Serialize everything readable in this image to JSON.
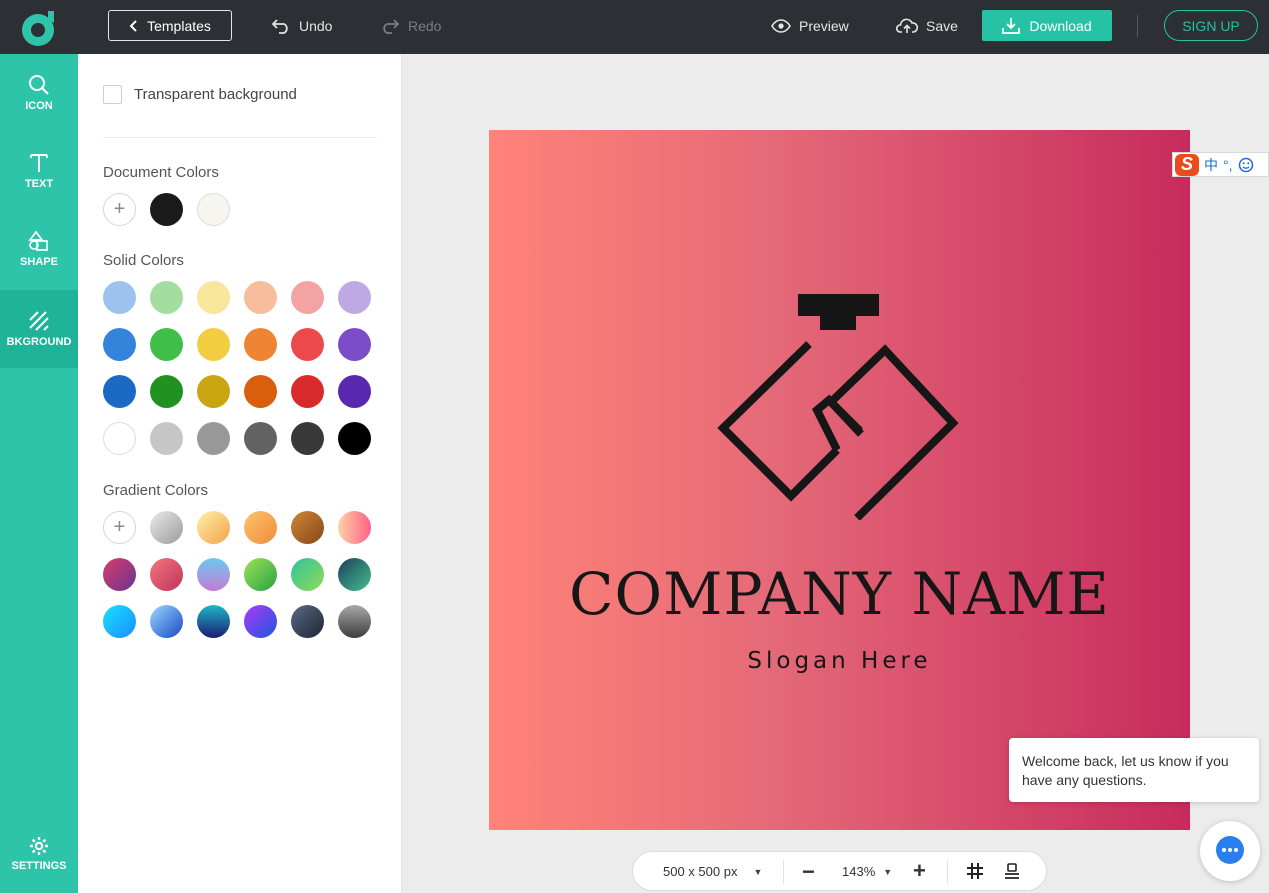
{
  "toolbar": {
    "templates_label": "Templates",
    "undo_label": "Undo",
    "redo_label": "Redo",
    "preview_label": "Preview",
    "save_label": "Save",
    "download_label": "Download",
    "signup_label": "SIGN UP"
  },
  "rail": {
    "items": [
      {
        "label": "ICON",
        "icon": "search-icon"
      },
      {
        "label": "TEXT",
        "icon": "text-icon"
      },
      {
        "label": "SHAPE",
        "icon": "shape-icon"
      },
      {
        "label": "BKGROUND",
        "icon": "background-icon",
        "active": true
      }
    ],
    "settings_label": "SETTINGS"
  },
  "panel": {
    "transparent_label": "Transparent background",
    "document_colors_title": "Document Colors",
    "solid_colors_title": "Solid Colors",
    "gradient_colors_title": "Gradient Colors",
    "document_colors": [
      "#1a1a1a",
      "#f6f5f0"
    ],
    "solid_colors": [
      [
        "#9cc2ef",
        "#a3dea0",
        "#f8e69a",
        "#f7be9c",
        "#f4a3a3",
        "#bfa9e5"
      ],
      [
        "#3484dc",
        "#3fbf48",
        "#f2cd42",
        "#ef8534",
        "#ec4a4a",
        "#7b4dc9"
      ],
      [
        "#1b69c2",
        "#21921f",
        "#c8a511",
        "#d95f0d",
        "#d82a2a",
        "#5a27b0"
      ],
      [
        "#ffffff",
        "#c6c6c6",
        "#989898",
        "#626262",
        "#393939",
        "#000000"
      ]
    ],
    "gradient_colors": [
      [
        null,
        "linear-gradient(135deg,#eaeaea,#9b9b9b)",
        "linear-gradient(135deg,#fff0a8,#f2a24a)",
        "linear-gradient(135deg,#ffc26b,#ee8d3b)",
        "linear-gradient(135deg,#cc8a3a,#8a4515)",
        "linear-gradient(90deg,#ffd2a6,#ff5f86)"
      ],
      [
        "linear-gradient(135deg,#d63d6a,#6b3492)",
        "linear-gradient(135deg,#f0787b,#c2325d)",
        "linear-gradient(180deg,#6ec8f0,#c57bd6)",
        "linear-gradient(135deg,#9be25a,#2ba142)",
        "linear-gradient(135deg,#30c29a,#8edc57)",
        "linear-gradient(135deg,#1c3f5d,#44c08d)"
      ],
      [
        "linear-gradient(135deg,#19e0ff,#1a8dff)",
        "linear-gradient(135deg,#9fd9ff,#1748c4)",
        "linear-gradient(180deg,#1fb6c8,#1b1b73)",
        "linear-gradient(135deg,#ad3cf5,#1d54e0)",
        "linear-gradient(135deg,#5a6b84,#1c2533)",
        "linear-gradient(180deg,#a8a8a8,#3d3d3d)"
      ]
    ]
  },
  "canvas": {
    "company_name": "COMPANY NAME",
    "slogan": "Slogan Here"
  },
  "ime": {
    "label_zh": "中",
    "punct": "°,"
  },
  "chat": {
    "message": "Welcome back, let us know if you have any questions."
  },
  "bottombar": {
    "size_label": "500 x 500 px",
    "zoom_label": "143%"
  },
  "colors": {
    "accent": "#2ec4aa",
    "topbar": "#2c2f33"
  }
}
